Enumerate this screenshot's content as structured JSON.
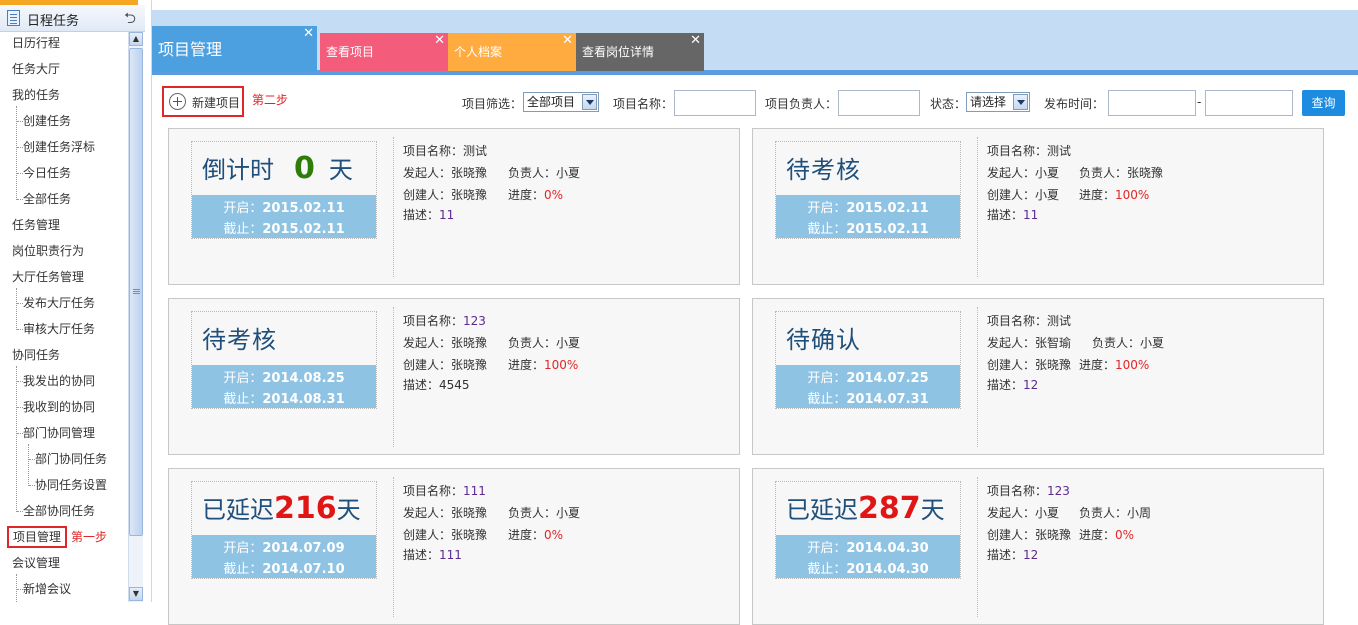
{
  "sidebar": {
    "title": "日程任务",
    "icon": "document-icon",
    "back_icon": "back-arrow-icon",
    "items": [
      {
        "label": "日历行程"
      },
      {
        "label": "任务大厅"
      },
      {
        "label": "我的任务"
      },
      {
        "label": "创建任务"
      },
      {
        "label": "创建任务浮标"
      },
      {
        "label": "今日任务"
      },
      {
        "label": "全部任务"
      },
      {
        "label": "任务管理"
      },
      {
        "label": "岗位职责行为"
      },
      {
        "label": "大厅任务管理"
      },
      {
        "label": "发布大厅任务"
      },
      {
        "label": "审核大厅任务"
      },
      {
        "label": "协同任务"
      },
      {
        "label": "我发出的协同"
      },
      {
        "label": "我收到的协同"
      },
      {
        "label": "部门协同管理"
      },
      {
        "label": "部门协同任务"
      },
      {
        "label": "协同任务设置"
      },
      {
        "label": "全部协同任务"
      },
      {
        "label": "项目管理"
      },
      {
        "label": "会议管理"
      },
      {
        "label": "新增会议"
      }
    ],
    "step1_note": "第一步"
  },
  "tabs": [
    {
      "label": "项目管理",
      "color": "#4da0e0"
    },
    {
      "label": "查看项目",
      "color": "#f45c7c"
    },
    {
      "label": "个人档案",
      "color": "#ffab40"
    },
    {
      "label": "查看岗位详情",
      "color": "#666666"
    }
  ],
  "toolbar": {
    "new_project": "新建项目",
    "step2_note": "第二步",
    "filter_label": "项目筛选：",
    "filter_value": "全部项目",
    "name_label": "项目名称：",
    "owner_label": "项目负责人：",
    "status_label": "状态：",
    "status_value": "请选择",
    "time_label": "发布时间：",
    "time_sep": "-",
    "query": "查询"
  },
  "labels": {
    "start": "开启：",
    "end": "截止：",
    "name": "项目名称：",
    "initiator": "发起人：",
    "owner": "负责人：",
    "creator": "创建人：",
    "progress": "进度：",
    "desc": "描述："
  },
  "cards": [
    {
      "status": "倒计时",
      "count": "0",
      "unit": "天",
      "start": "2015.02.11",
      "end": "2015.02.11",
      "name": "测试",
      "initiator": "张晓豫",
      "owner": "小夏",
      "creator": "张晓豫",
      "progress": "0%",
      "desc": "11"
    },
    {
      "status": "待考核",
      "start": "2015.02.11",
      "end": "2015.02.11",
      "name": "测试",
      "initiator": "小夏",
      "owner": "张晓豫",
      "creator": "小夏",
      "progress": "100%",
      "desc": "11"
    },
    {
      "status": "待考核",
      "start": "2014.08.25",
      "end": "2014.08.31",
      "name": "123",
      "initiator": "张晓豫",
      "owner": "小夏",
      "creator": "张晓豫",
      "progress": "100%",
      "desc": "4545"
    },
    {
      "status": "待确认",
      "start": "2014.07.25",
      "end": "2014.07.31",
      "name": "测试",
      "initiator": "张智瑜",
      "owner": "小夏",
      "creator": "张晓豫",
      "progress": "100%",
      "desc": "12"
    },
    {
      "status": "已延迟",
      "count": "216",
      "unit": "天",
      "start": "2014.07.09",
      "end": "2014.07.10",
      "name": "111",
      "initiator": "张晓豫",
      "owner": "小夏",
      "creator": "张晓豫",
      "progress": "0%",
      "desc": "111"
    },
    {
      "status": "已延迟",
      "count": "287",
      "unit": "天",
      "start": "2014.04.30",
      "end": "2014.04.30",
      "name": "123",
      "initiator": "小夏",
      "owner": "小周",
      "creator": "张晓豫",
      "progress": "0%",
      "desc": "12"
    }
  ]
}
